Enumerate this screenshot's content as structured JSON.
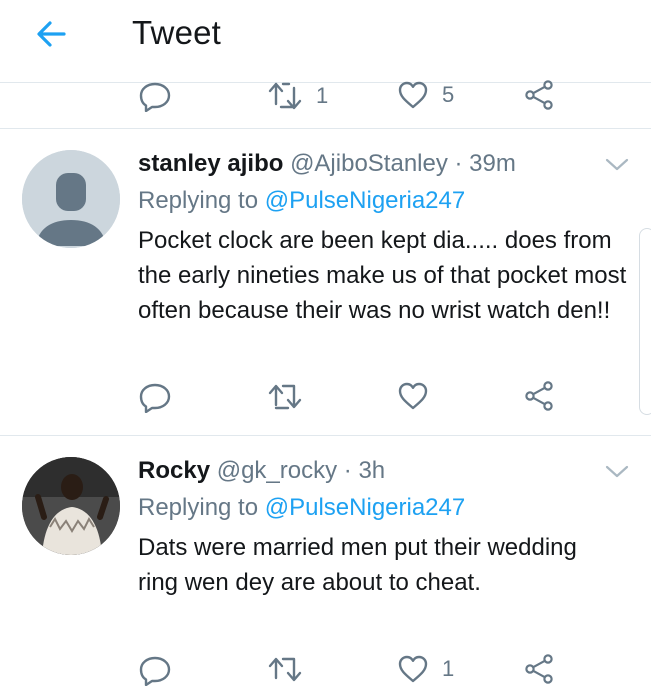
{
  "header": {
    "title": "Tweet"
  },
  "top_actions": {
    "retweets": "1",
    "likes": "5"
  },
  "tweets": [
    {
      "name": "stanley ajibo",
      "handle": "@AjiboStanley",
      "time": "· 39m",
      "replying_prefix": "Replying to",
      "replying_handle": "@PulseNigeria247",
      "text": "Pocket clock are been kept dia..... does from the early nineties make us of that pocket most often because their was no wrist watch den!!"
    },
    {
      "name": "Rocky",
      "handle": "@gk_rocky",
      "time": "· 3h",
      "replying_prefix": "Replying to",
      "replying_handle": "@PulseNigeria247",
      "text": "Dats were married men put their wedding ring wen dey are about  to cheat.",
      "likes": "1"
    }
  ],
  "colors": {
    "accent": "#1da1f2",
    "muted": "#657786",
    "divider": "#e1e8ed"
  },
  "icons": [
    "back-arrow-icon",
    "reply-icon",
    "retweet-icon",
    "like-icon",
    "share-icon",
    "chevron-down-icon"
  ]
}
